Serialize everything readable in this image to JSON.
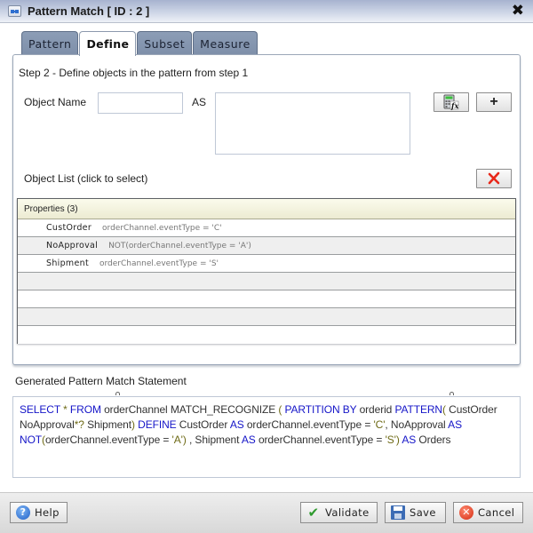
{
  "window": {
    "title": "Pattern Match [ ID : 2 ]",
    "close_glyph": "✖"
  },
  "tabs": [
    {
      "label": "Pattern",
      "active": false
    },
    {
      "label": "Define",
      "active": true
    },
    {
      "label": "Subset",
      "active": false
    },
    {
      "label": "Measure",
      "active": false
    }
  ],
  "define": {
    "step_label": "Step 2 - Define objects in the pattern from step 1",
    "object_name_label": "Object Name",
    "object_name_value": "",
    "as_label": "AS",
    "as_value": "",
    "add_glyph": "+",
    "object_list_label": "Object List (click to select)",
    "table": {
      "header": "Properties (3)",
      "rows": [
        {
          "name": "CustOrder",
          "expr": "orderChannel.eventType = 'C'"
        },
        {
          "name": "NoApproval",
          "expr": "NOT(orderChannel.eventType = 'A')"
        },
        {
          "name": "Shipment",
          "expr": "orderChannel.eventType = 'S'"
        },
        {
          "name": "",
          "expr": ""
        },
        {
          "name": "",
          "expr": ""
        },
        {
          "name": "",
          "expr": ""
        },
        {
          "name": "",
          "expr": ""
        }
      ]
    }
  },
  "generated": {
    "label": "Generated Pattern Match Statement",
    "tokens": [
      {
        "t": "SELECT",
        "c": "kw"
      },
      {
        "t": " * ",
        "c": "pn"
      },
      {
        "t": "FROM",
        "c": "kw"
      },
      {
        "t": " orderChannel  MATCH_RECOGNIZE ",
        "c": "tx"
      },
      {
        "t": "( ",
        "c": "pn"
      },
      {
        "t": "PARTITION BY",
        "c": "kw"
      },
      {
        "t": " orderid ",
        "c": "tx"
      },
      {
        "t": "PATTERN",
        "c": "kw"
      },
      {
        "t": "( ",
        "c": "pn"
      },
      {
        "t": "CustOrder NoApproval",
        "c": "tx"
      },
      {
        "t": "*? ",
        "c": "pn"
      },
      {
        "t": "Shipment",
        "c": "tx"
      },
      {
        "t": ") ",
        "c": "pn"
      },
      {
        "t": "DEFINE",
        "c": "kw"
      },
      {
        "t": " CustOrder ",
        "c": "tx"
      },
      {
        "t": "AS",
        "c": "kw"
      },
      {
        "t": " orderChannel.eventType = ",
        "c": "tx"
      },
      {
        "t": "'C'",
        "c": "pn"
      },
      {
        "t": ", NoApproval ",
        "c": "tx"
      },
      {
        "t": "AS",
        "c": "kw"
      },
      {
        "t": " ",
        "c": "tx"
      },
      {
        "t": "NOT",
        "c": "kw"
      },
      {
        "t": "(",
        "c": "pn"
      },
      {
        "t": "orderChannel.eventType = ",
        "c": "tx"
      },
      {
        "t": "'A')",
        "c": "pn"
      },
      {
        "t": " , Shipment ",
        "c": "tx"
      },
      {
        "t": "AS",
        "c": "kw"
      },
      {
        "t": " orderChannel.eventType = ",
        "c": "tx"
      },
      {
        "t": "'S')",
        "c": "pn"
      },
      {
        "t": " ",
        "c": "tx"
      },
      {
        "t": "AS",
        "c": "kw"
      },
      {
        "t": " Orders",
        "c": "tx"
      }
    ]
  },
  "footer": {
    "help_label": "Help",
    "validate_label": "Validate",
    "save_label": "Save",
    "cancel_label": "Cancel"
  },
  "colors": {
    "keyword": "#1515c8",
    "punctuation": "#6e6a16",
    "tab_inactive": "#8c9db6",
    "title_gradient_top": "#a7b3cf"
  }
}
